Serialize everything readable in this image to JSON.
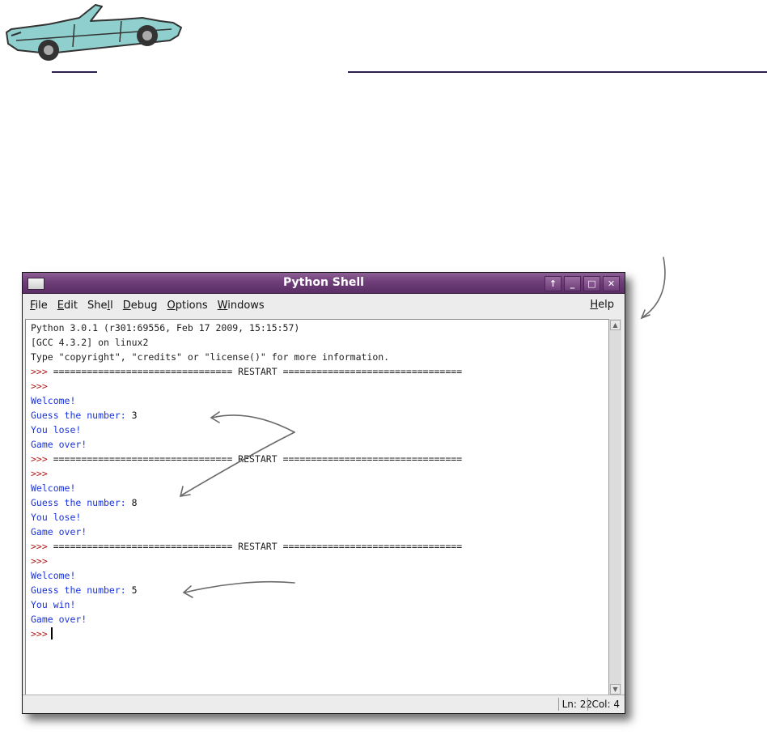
{
  "window": {
    "title": "Python Shell",
    "buttons": [
      "↑",
      "_",
      "□",
      "✕"
    ]
  },
  "menubar": {
    "items": [
      {
        "pre": "",
        "u": "F",
        "post": "ile"
      },
      {
        "pre": "",
        "u": "E",
        "post": "dit"
      },
      {
        "pre": "She",
        "u": "l",
        "post": "l"
      },
      {
        "pre": "",
        "u": "D",
        "post": "ebug"
      },
      {
        "pre": "",
        "u": "O",
        "post": "ptions"
      },
      {
        "pre": "",
        "u": "W",
        "post": "indows"
      }
    ],
    "help": {
      "pre": "",
      "u": "H",
      "post": "elp"
    }
  },
  "shell": {
    "lines": [
      {
        "kind": "out",
        "text": "Python 3.0.1 (r301:69556, Feb 17 2009, 15:15:57)"
      },
      {
        "kind": "out",
        "text": "[GCC 4.3.2] on linux2"
      },
      {
        "kind": "out",
        "text": "Type \"copyright\", \"credits\" or \"license()\" for more information."
      },
      {
        "kind": "restart",
        "prompt": ">>> ",
        "text": "================================ RESTART ================================"
      },
      {
        "kind": "prompt",
        "prompt": ">>>",
        "text": ""
      },
      {
        "kind": "blue",
        "text": "Welcome!"
      },
      {
        "kind": "input",
        "text": "Guess the number: ",
        "value": "3"
      },
      {
        "kind": "blue",
        "text": "You lose!"
      },
      {
        "kind": "blue",
        "text": "Game over!"
      },
      {
        "kind": "restart",
        "prompt": ">>> ",
        "text": "================================ RESTART ================================"
      },
      {
        "kind": "prompt",
        "prompt": ">>>",
        "text": ""
      },
      {
        "kind": "blue",
        "text": "Welcome!"
      },
      {
        "kind": "input",
        "text": "Guess the number: ",
        "value": "8"
      },
      {
        "kind": "blue",
        "text": "You lose!"
      },
      {
        "kind": "blue",
        "text": "Game over!"
      },
      {
        "kind": "restart",
        "prompt": ">>> ",
        "text": "================================ RESTART ================================"
      },
      {
        "kind": "prompt",
        "prompt": ">>>",
        "text": ""
      },
      {
        "kind": "blue",
        "text": "Welcome!"
      },
      {
        "kind": "input",
        "text": "Guess the number: ",
        "value": "5"
      },
      {
        "kind": "blue",
        "text": "You win!"
      },
      {
        "kind": "blue",
        "text": "Game over!"
      },
      {
        "kind": "cursor",
        "prompt": ">>>",
        "text": ""
      }
    ]
  },
  "status": {
    "line": "Ln: 22",
    "col": "Col: 4"
  },
  "colors": {
    "titlebar": "#6e3e78",
    "prompt": "#b31a1a",
    "program_output": "#1a33d9",
    "rule": "#2a1f4e",
    "car_body": "#8fd0cf"
  },
  "icons": {
    "header_illustration": "car-icon"
  }
}
